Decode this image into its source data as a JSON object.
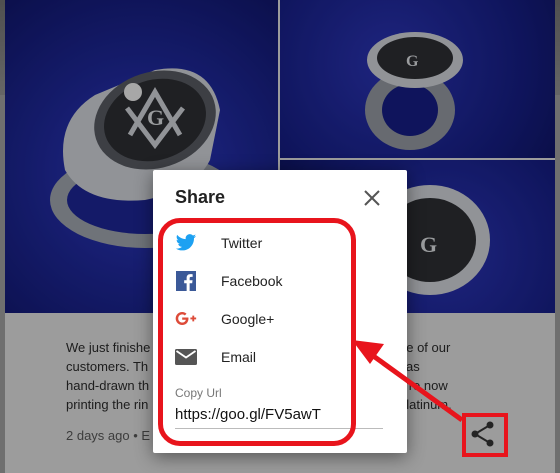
{
  "post": {
    "line1a": "We just finishe",
    "line1b": "ne of our",
    "line2a": "customers.  Th",
    "line2b": "as",
    "line3a": "hand-drawn th",
    "line3b": "e're now",
    "line4a": "printing the rin",
    "line4b": "platinum.",
    "meta": "2 days ago • E"
  },
  "dialog": {
    "title": "Share",
    "items": [
      {
        "label": "Twitter",
        "icon": "twitter-icon",
        "color": "#1da1f2"
      },
      {
        "label": "Facebook",
        "icon": "facebook-icon",
        "color": "#3b5998"
      },
      {
        "label": "Google+",
        "icon": "google-plus-icon",
        "color": "#dd4b39"
      },
      {
        "label": "Email",
        "icon": "email-icon",
        "color": "#555555"
      }
    ],
    "copy_label": "Copy Url",
    "copy_value": "https://goo.gl/FV5awT"
  },
  "colors": {
    "highlight": "#e8141c",
    "photo_bg": "#1c2590"
  }
}
